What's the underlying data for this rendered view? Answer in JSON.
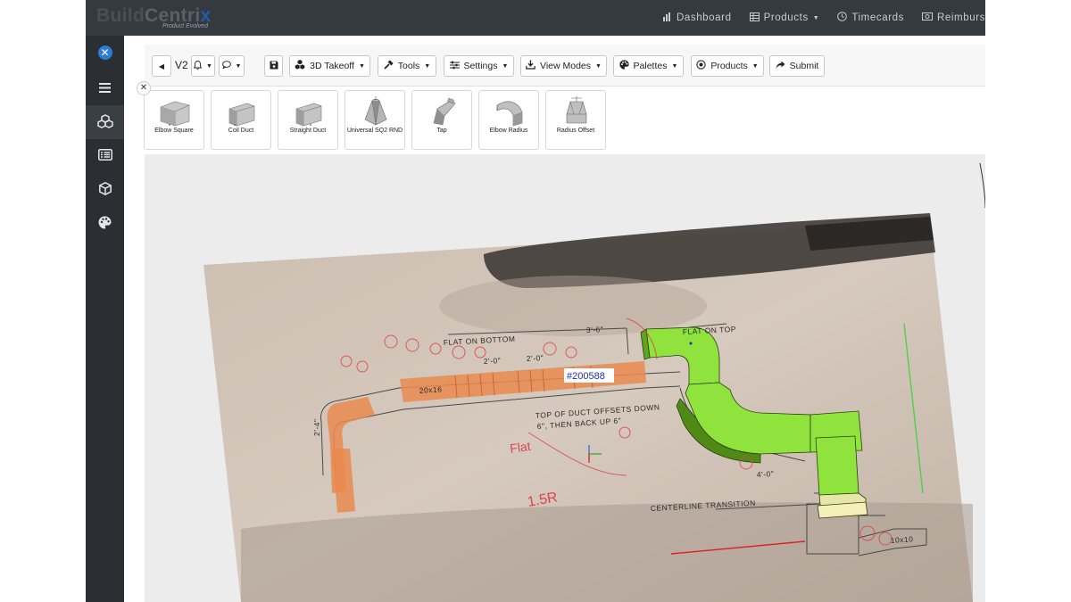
{
  "app": {
    "brand_part1": "Build",
    "brand_part2": "Centri",
    "brand_part3": "x",
    "brand_tagline": "Product Evolved"
  },
  "nav": {
    "items": [
      {
        "label": "Dashboard",
        "icon": "bar-chart-icon"
      },
      {
        "label": "Products",
        "icon": "table-icon"
      },
      {
        "label": "Timecards",
        "icon": "clock-icon"
      },
      {
        "label": "Reimburs",
        "icon": "money-icon"
      }
    ]
  },
  "sidebar": {
    "items": [
      {
        "icon": "logo-icon"
      },
      {
        "icon": "menu-icon"
      },
      {
        "icon": "cubes-icon"
      },
      {
        "icon": "list-icon"
      },
      {
        "icon": "cube-icon"
      },
      {
        "icon": "palette-icon"
      }
    ]
  },
  "toolbar": {
    "version": "V2",
    "takeoff_label": "3D Takeoff",
    "tools_label": "Tools",
    "settings_label": "Settings",
    "view_modes_label": "View Modes",
    "palettes_label": "Palettes",
    "products_label": "Products",
    "submit_label": "Submit"
  },
  "palette": {
    "items": [
      {
        "label": "Elbow Square"
      },
      {
        "label": "Coil Duct"
      },
      {
        "label": "Straight Duct"
      },
      {
        "label": "Universal SQ2 RND"
      },
      {
        "label": "Tap"
      },
      {
        "label": "Elbow Radius"
      },
      {
        "label": "Radius Offset"
      }
    ]
  },
  "viewport": {
    "tag": "#200588",
    "notes": {
      "flat_bottom": "FLAT ON BOTTOM",
      "flat_top": "FLAT ON TOP",
      "offset_line1": "TOP OF DUCT OFFSETS DOWN",
      "offset_line2": "6\", THEN BACK UP 6\"",
      "transition": "CENTERLINE TRANSITION",
      "dim_3_6": "3'-6\"",
      "dim_2_0a": "2'-0\"",
      "dim_2_0b": "2'-0\"",
      "dim_4_0": "4'-0\"",
      "dim_2_4": "2'-4\"",
      "size_20x16": "20x16",
      "size_10x10": "10x10",
      "hand_flat": "Flat",
      "hand_15r": "1.5R"
    }
  }
}
